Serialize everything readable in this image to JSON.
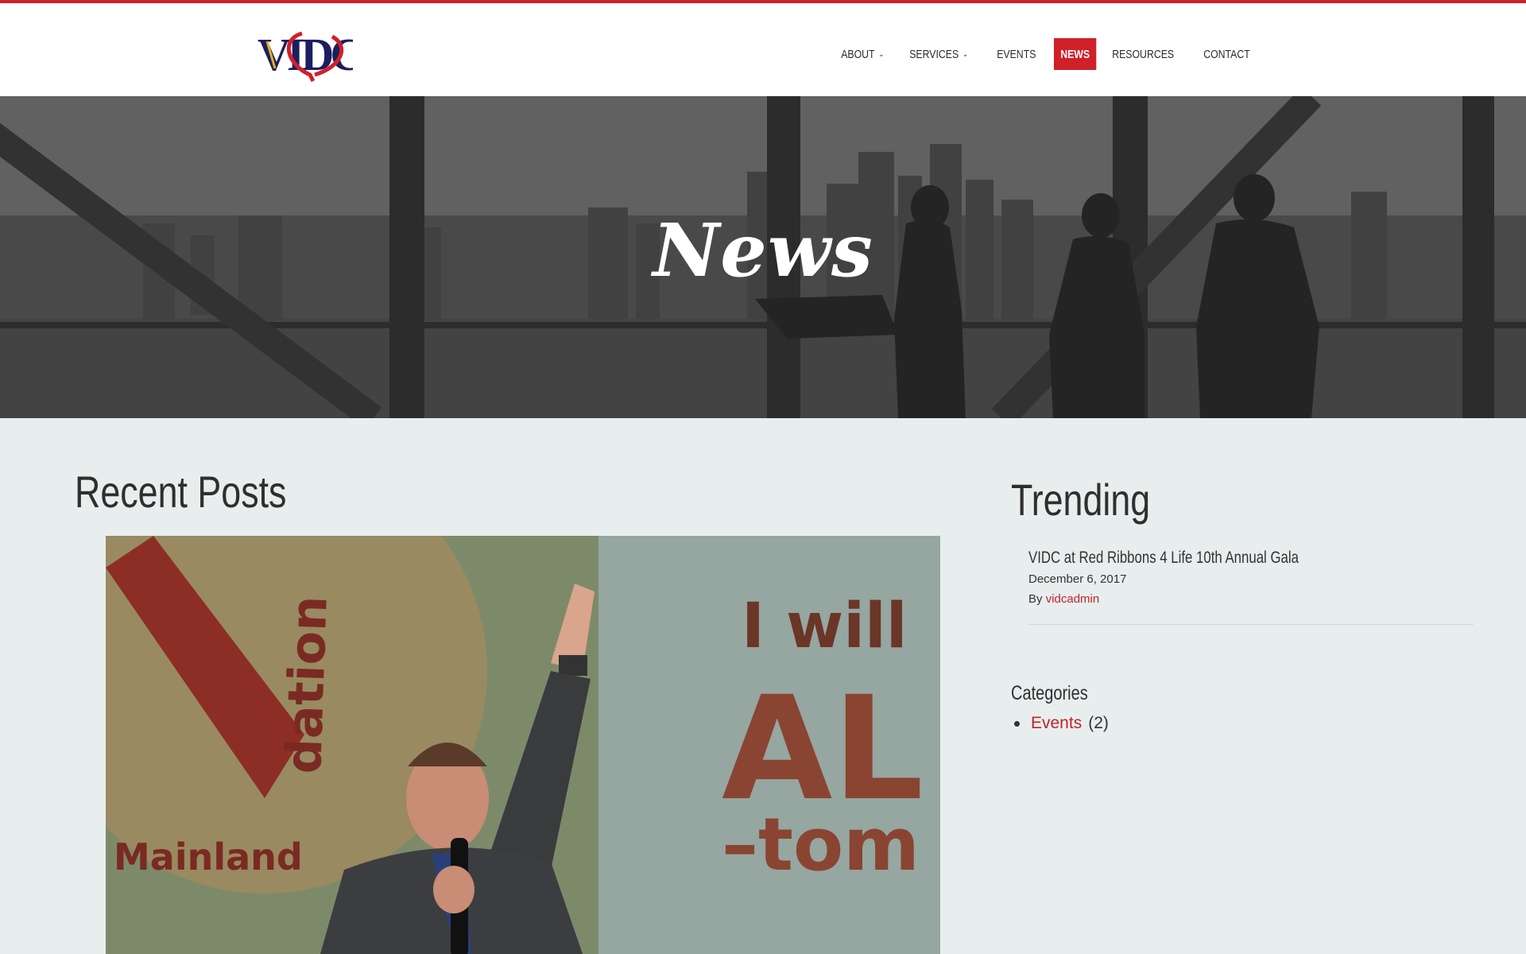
{
  "site": {
    "logo_text": "VIDC",
    "accent": "#d0202a",
    "logo_navy": "#1b1f5e",
    "logo_gold": "#e6b21a"
  },
  "nav": {
    "items": [
      {
        "label": "About",
        "has_dropdown": true
      },
      {
        "label": "Services",
        "has_dropdown": true
      },
      {
        "label": "Events",
        "has_dropdown": false
      },
      {
        "label": "News",
        "has_dropdown": false,
        "active": true
      },
      {
        "label": "Resources",
        "has_dropdown": false
      },
      {
        "label": "Contact",
        "has_dropdown": false
      }
    ],
    "chevron_icon": "chevron-down-icon"
  },
  "hero": {
    "title": "News"
  },
  "main": {
    "recent_title": "Recent Posts",
    "post_image_text": {
      "banner": "I will",
      "big": "AL",
      "sub": "–tom",
      "circle_word": "dation",
      "circle_word2": "Mainland"
    }
  },
  "sidebar": {
    "trending_title": "Trending",
    "trending": [
      {
        "title": "VIDC at Red Ribbons 4 Life 10th Annual Gala",
        "date": "December 6, 2017",
        "by_label": "By",
        "author": "vidcadmin"
      }
    ],
    "categories_title": "Categories",
    "categories": [
      {
        "name": "Events",
        "count": "(2)"
      }
    ]
  }
}
